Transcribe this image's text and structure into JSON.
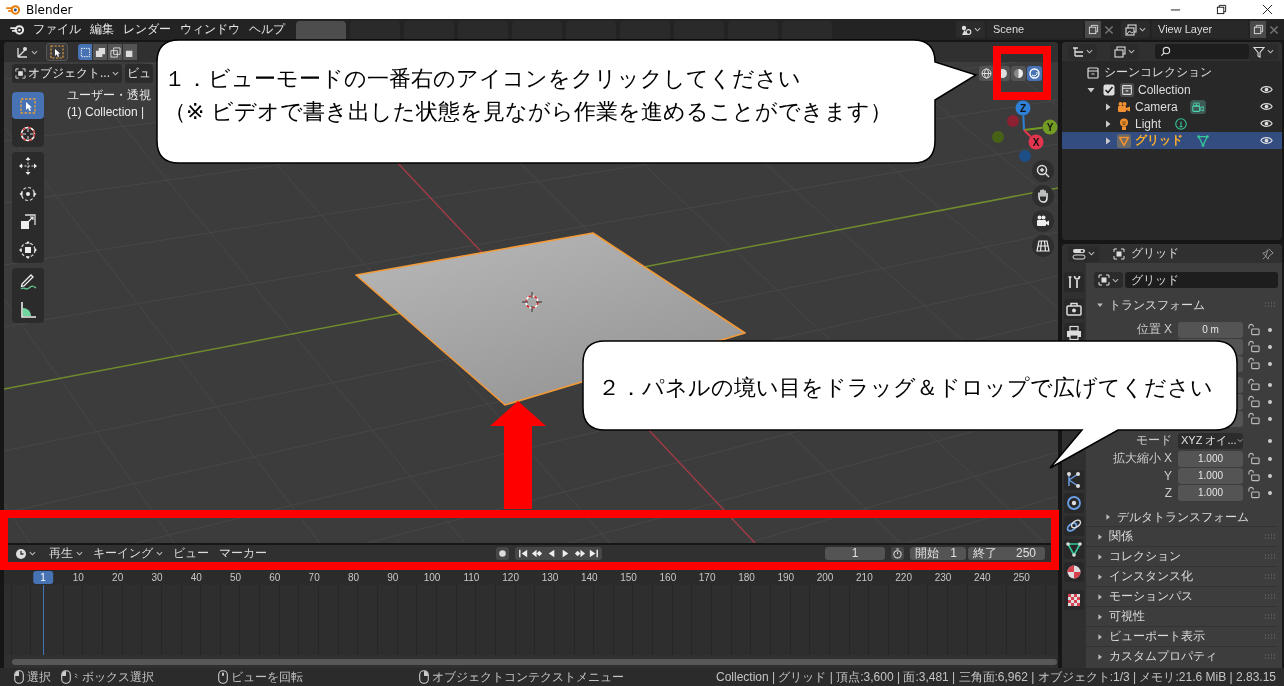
{
  "window": {
    "title": "Blender"
  },
  "topbar": {
    "menu": [
      "ファイル",
      "編集",
      "レンダー",
      "ウィンドウ",
      "ヘルプ"
    ],
    "workspace_tabs": [
      {
        "selected": true
      },
      {
        "selected": false
      },
      {
        "selected": false
      },
      {
        "selected": false
      },
      {
        "selected": false
      },
      {
        "selected": false
      },
      {
        "selected": false
      },
      {
        "selected": false
      },
      {
        "selected": false
      },
      {
        "selected": false
      }
    ],
    "scene": "Scene",
    "view_layer": "View Layer"
  },
  "viewport": {
    "select_modes": [
      {
        "selected": true
      },
      {
        "selected": false
      },
      {
        "selected": false
      },
      {
        "selected": false
      }
    ],
    "mode": "オブジェクト...",
    "menu": [
      "ビュ"
    ],
    "info": [
      "ユーザー・透視",
      "(1) Collection |"
    ],
    "tools": [
      [
        {
          "selected": true
        },
        {
          "selected": false
        }
      ],
      [
        {
          "selected": false
        },
        {
          "selected": false
        },
        {
          "selected": false
        },
        {
          "selected": false
        }
      ],
      [
        {
          "selected": false
        },
        {
          "selected": false
        }
      ]
    ],
    "shading": [
      {
        "selected": false
      },
      {
        "selected": false
      },
      {
        "selected": false
      },
      {
        "selected": true
      }
    ],
    "gizmo": [
      {
        "label": "Z",
        "color": "#2f80d8"
      },
      {
        "label": "Y",
        "color": "#739c25"
      },
      {
        "label": "X",
        "color": "#e4354f"
      }
    ]
  },
  "timeline": {
    "menus": [
      {
        "label": "再生",
        "dropdown": true
      },
      {
        "label": "キーイング",
        "dropdown": true
      },
      {
        "label": "ビュー",
        "dropdown": false
      },
      {
        "label": "マーカー",
        "dropdown": false
      }
    ],
    "frame": "1",
    "start": {
      "label": "開始",
      "value": "1"
    },
    "end": {
      "label": "終了",
      "value": "250"
    },
    "ruler": [
      {
        "label": "1",
        "selected": true
      },
      {
        "label": "10",
        "selected": false
      },
      {
        "label": "20",
        "selected": false
      },
      {
        "label": "30",
        "selected": false
      },
      {
        "label": "40",
        "selected": false
      },
      {
        "label": "50",
        "selected": false
      },
      {
        "label": "60",
        "selected": false
      },
      {
        "label": "70",
        "selected": false
      },
      {
        "label": "80",
        "selected": false
      },
      {
        "label": "90",
        "selected": false
      },
      {
        "label": "100",
        "selected": false
      },
      {
        "label": "110",
        "selected": false
      },
      {
        "label": "120",
        "selected": false
      },
      {
        "label": "130",
        "selected": false
      },
      {
        "label": "140",
        "selected": false
      },
      {
        "label": "150",
        "selected": false
      },
      {
        "label": "160",
        "selected": false
      },
      {
        "label": "170",
        "selected": false
      },
      {
        "label": "180",
        "selected": false
      },
      {
        "label": "190",
        "selected": false
      },
      {
        "label": "200",
        "selected": false
      },
      {
        "label": "210",
        "selected": false
      },
      {
        "label": "220",
        "selected": false
      },
      {
        "label": "230",
        "selected": false
      },
      {
        "label": "240",
        "selected": false
      },
      {
        "label": "250",
        "selected": false
      }
    ]
  },
  "outliner": {
    "tree": [
      {
        "kind": "scene_collection",
        "label": "シーンコレクション",
        "children": [
          {
            "kind": "collection",
            "label": "Collection",
            "expanded": true,
            "checked": true,
            "selected": false,
            "children": [
              {
                "kind": "camera",
                "label": "Camera",
                "expanded": false,
                "selected": false
              },
              {
                "kind": "light",
                "label": "Light",
                "expanded": false,
                "selected": false
              },
              {
                "kind": "mesh",
                "label": "グリッド",
                "expanded": false,
                "selected": true
              }
            ]
          }
        ]
      }
    ]
  },
  "properties": {
    "object": "グリッド",
    "name": "グリッド",
    "transform": {
      "title": "トランスフォーム",
      "expanded": true,
      "groups": [
        [
          {
            "kind": "number",
            "label": "位置 X",
            "value": "0 m",
            "lockable": true
          },
          {
            "kind": "number",
            "lockable": true
          },
          {
            "kind": "number",
            "lockable": true
          }
        ],
        [
          {
            "kind": "number",
            "lockable": true
          },
          {
            "kind": "number",
            "lockable": true
          },
          {
            "kind": "number",
            "lockable": true
          }
        ],
        [
          {
            "kind": "dropdown",
            "label": "モード",
            "value": "XYZ オイ..."
          }
        ],
        [
          {
            "kind": "number",
            "label": "拡大縮小 X",
            "value": "1.000",
            "lockable": true
          },
          {
            "kind": "number",
            "label": "Y",
            "value": "1.000",
            "lockable": true
          },
          {
            "kind": "number",
            "label": "Z",
            "value": "1.000",
            "lockable": true
          }
        ]
      ]
    },
    "delta": {
      "title": "デルタトランスフォーム",
      "expanded": false
    },
    "panels": [
      {
        "title": "関係",
        "expanded": false
      },
      {
        "title": "コレクション",
        "expanded": false
      },
      {
        "title": "インスタンス化",
        "expanded": false
      },
      {
        "title": "モーションパス",
        "expanded": false
      },
      {
        "title": "可視性",
        "expanded": false
      },
      {
        "title": "ビューポート表示",
        "expanded": false
      },
      {
        "title": "カスタムプロパティ",
        "expanded": false
      }
    ]
  },
  "status_bar": {
    "hints": [
      {
        "kind": "lmb",
        "label": "選択"
      },
      {
        "kind": "lmb_drag",
        "label": "ボックス選択"
      },
      {
        "kind": "mmb",
        "label": "ビューを回転"
      },
      {
        "kind": "rmb",
        "label": "オブジェクトコンテクストメニュー"
      }
    ],
    "stats": "Collection | グリッド | 頂点:3,600 | 面:3,481 | 三角面:6,962 | オブジェクト:1/3 | メモリ:21.6 MiB | 2.83.15"
  },
  "annotations": {
    "callouts": [
      {
        "lines": [
          "１．ビューモードの一番右のアイコンをクリックしてください",
          "（※ ビデオで書き出した状態を見ながら作業を進めることができます）"
        ]
      },
      {
        "lines": [
          "２．パネルの境い目をドラッグ＆ドロップで広げてください"
        ]
      }
    ]
  }
}
